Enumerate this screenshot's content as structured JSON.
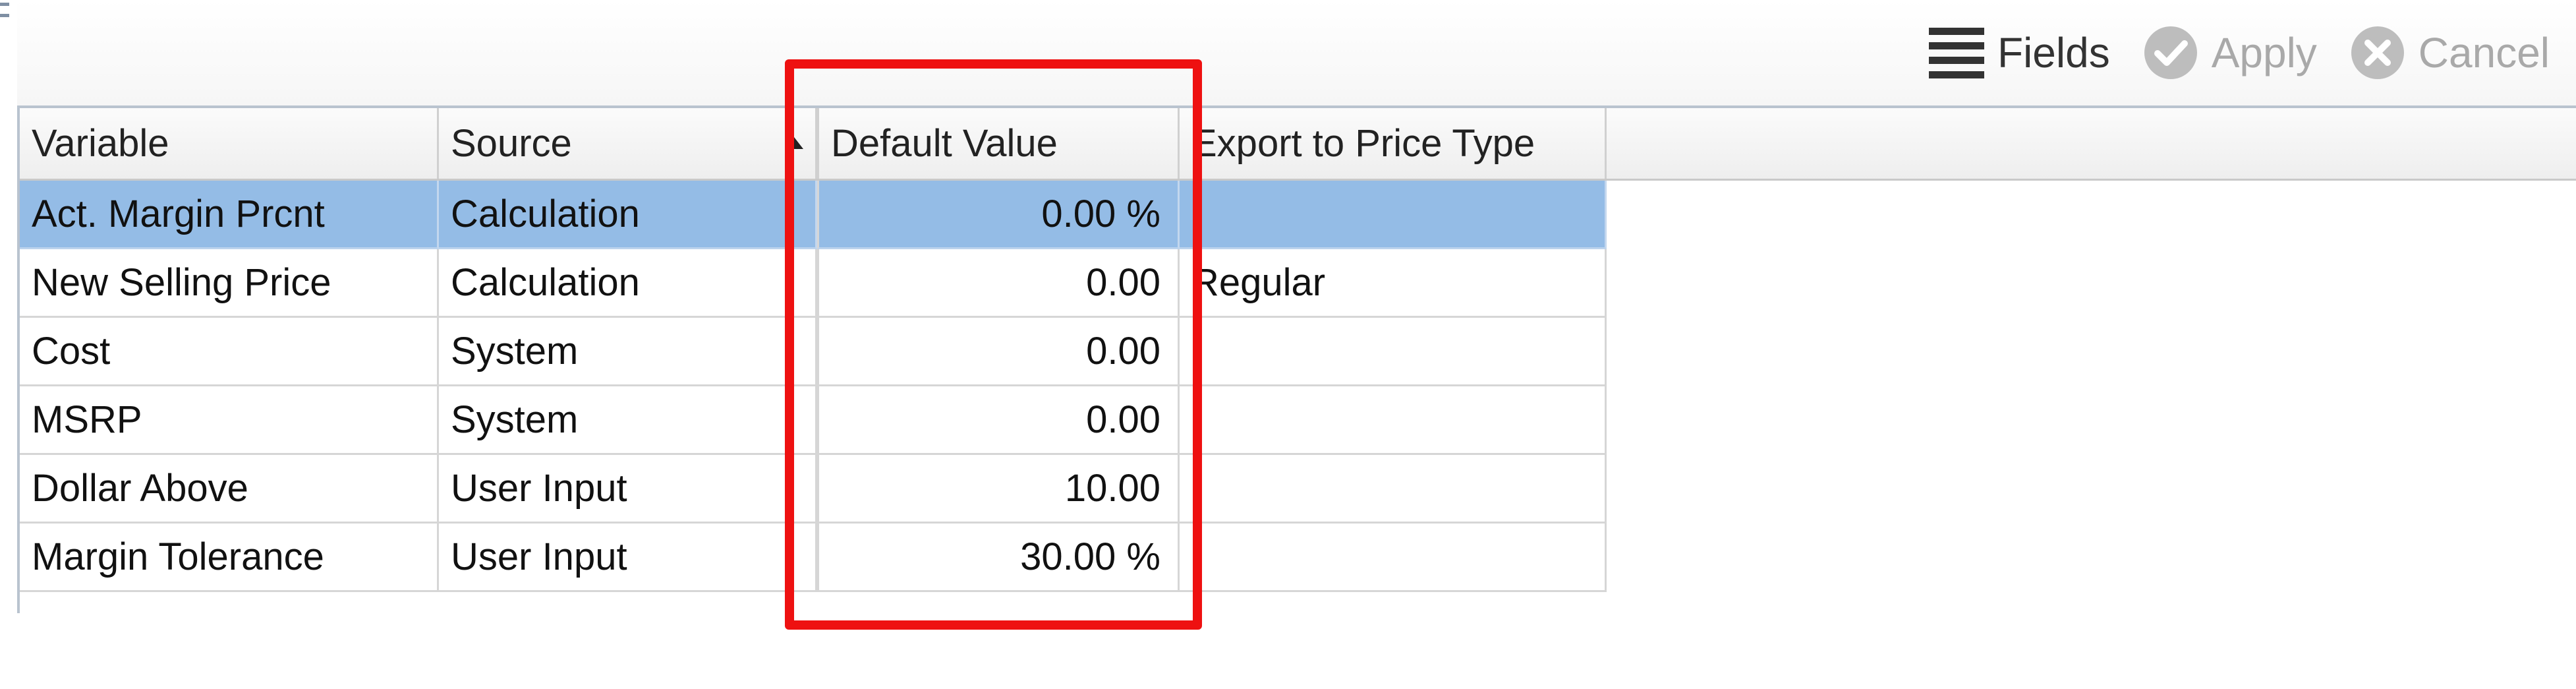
{
  "toolbar": {
    "fields_label": "Fields",
    "apply_label": "Apply",
    "cancel_label": "Cancel",
    "icons": {
      "fields": "list-lines-icon",
      "apply": "check-circle-icon",
      "cancel": "x-circle-icon"
    }
  },
  "grid": {
    "columns": [
      "Variable",
      "Source",
      "Default Value",
      "Export to Price Type"
    ],
    "sort": {
      "column": "Source",
      "direction": "ascending"
    },
    "rows": [
      {
        "variable": "Act. Margin Prcnt",
        "source": "Calculation",
        "default_value": "0.00 %",
        "export": "",
        "selected": true
      },
      {
        "variable": "New Selling Price",
        "source": "Calculation",
        "default_value": "0.00",
        "export": "Regular",
        "selected": false
      },
      {
        "variable": "Cost",
        "source": "System",
        "default_value": "0.00",
        "export": "",
        "selected": false
      },
      {
        "variable": "MSRP",
        "source": "System",
        "default_value": "0.00",
        "export": "",
        "selected": false
      },
      {
        "variable": "Dollar Above",
        "source": "User Input",
        "default_value": "10.00",
        "export": "",
        "selected": false
      },
      {
        "variable": "Margin Tolerance",
        "source": "User Input",
        "default_value": "30.00 %",
        "export": "",
        "selected": false
      }
    ]
  },
  "colors": {
    "selected_row": "#94bce6",
    "highlight_box": "#ee1111"
  }
}
